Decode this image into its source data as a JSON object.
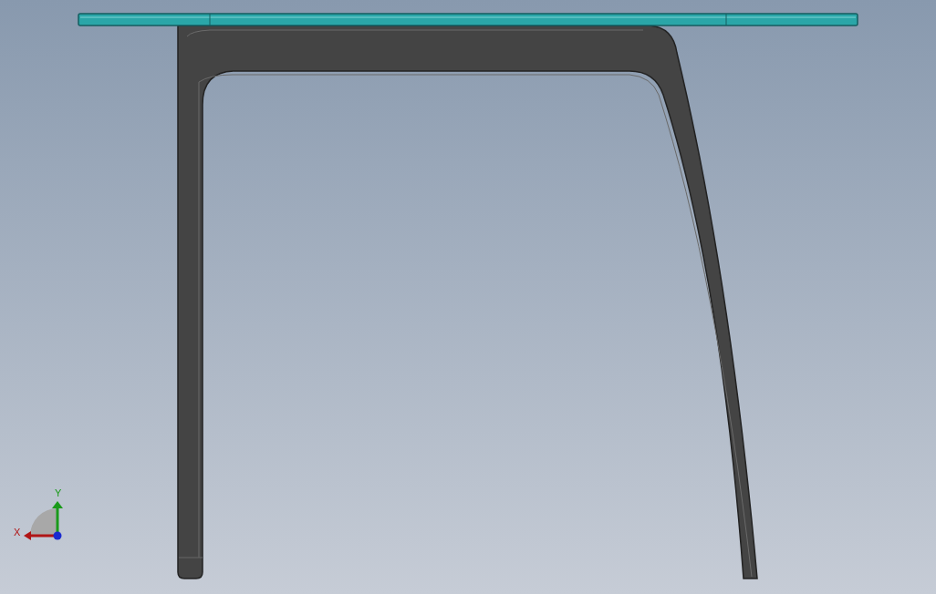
{
  "triad": {
    "x_label": "X",
    "y_label": "Y"
  }
}
